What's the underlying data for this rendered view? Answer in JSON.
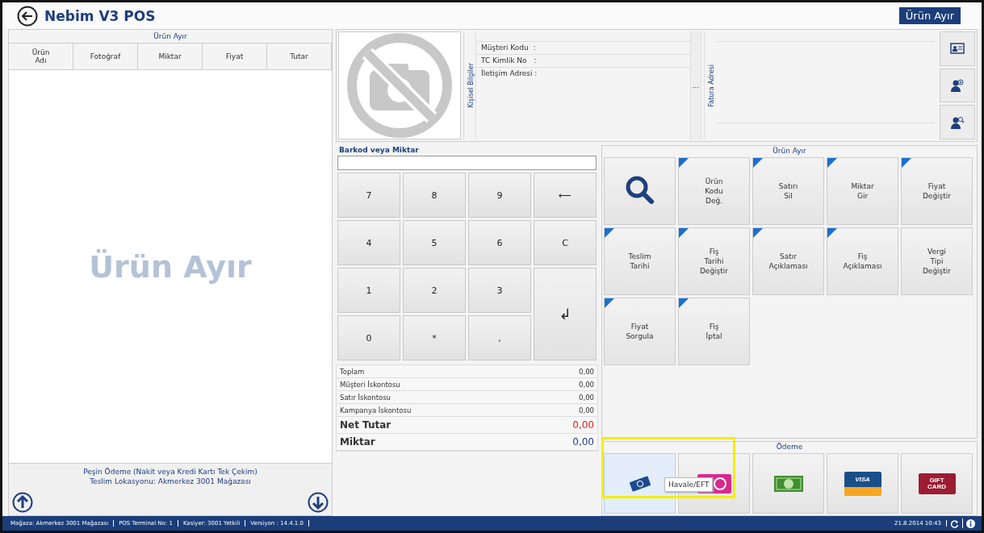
{
  "window": {
    "title": "Nebim V3 POS",
    "action_button": "Ürün Ayır"
  },
  "left_panel": {
    "title": "Ürün Ayır",
    "columns": [
      "Ürün\nAdı",
      "Fotoğraf",
      "Miktar",
      "Fiyat",
      "Tutar"
    ],
    "empty_text": "Ürün Ayır",
    "info_lines": [
      "Peşin Ödeme (Nakit veya Kredi Kartı Tek Çekim)",
      "Teslim Lokasyonu: Akmerkez 3001 Mağazası"
    ]
  },
  "customer": {
    "section_label": "Kişisel Bilgiler",
    "fields": [
      "Müşteri Kodu  :",
      "TC Kimlik No   :",
      "İletişim Adresi :"
    ],
    "address_label": "Fatura Adresi",
    "splitter": "..."
  },
  "barcode": {
    "label": "Barkod veya Miktar"
  },
  "keypad": [
    {
      "label": "7",
      "kind": "digit"
    },
    {
      "label": "8",
      "kind": "digit"
    },
    {
      "label": "9",
      "kind": "digit"
    },
    {
      "label": "⟵",
      "kind": "digit"
    },
    {
      "label": "4",
      "kind": "digit"
    },
    {
      "label": "5",
      "kind": "digit"
    },
    {
      "label": "6",
      "kind": "digit"
    },
    {
      "label": "C",
      "kind": "digit"
    },
    {
      "label": "1",
      "kind": "digit"
    },
    {
      "label": "2",
      "kind": "digit"
    },
    {
      "label": "3",
      "kind": "digit"
    },
    {
      "label": "↲",
      "kind": "enter"
    },
    {
      "label": "0",
      "kind": "digit"
    },
    {
      "label": "*",
      "kind": "digit"
    },
    {
      "label": ",",
      "kind": "digit"
    }
  ],
  "totals": [
    {
      "label": "Toplam",
      "value": "0,00",
      "kind": "plain"
    },
    {
      "label": "Müşteri İskontosu",
      "value": "0,00",
      "kind": "plain"
    },
    {
      "label": "Satır İskontosu",
      "value": "0,00",
      "kind": "plain"
    },
    {
      "label": "Kampanya İskontosu",
      "value": "0,00",
      "kind": "plain"
    },
    {
      "label": "Net Tutar",
      "value": "0,00",
      "kind": "net"
    },
    {
      "label": "Miktar",
      "value": "0,00",
      "kind": "count"
    }
  ],
  "functions": {
    "title": "Ürün Ayır",
    "buttons": [
      {
        "kind": "search",
        "flagged": false
      },
      {
        "kind": "text",
        "label": "Ürün\nKodu\nDeğ.",
        "flagged": true
      },
      {
        "kind": "text",
        "label": "Satırı\nSil",
        "flagged": true
      },
      {
        "kind": "text",
        "label": "Miktar\nGir",
        "flagged": true
      },
      {
        "kind": "text",
        "label": "Fiyat\nDeğiştir",
        "flagged": true
      },
      {
        "kind": "text",
        "label": "Teslim\nTarihi",
        "flagged": true
      },
      {
        "kind": "text",
        "label": "Fiş\nTarihi\nDeğiştir",
        "flagged": true
      },
      {
        "kind": "text",
        "label": "Satır\nAçıklaması",
        "flagged": true
      },
      {
        "kind": "text",
        "label": "Fiş\nAçıklaması",
        "flagged": true
      },
      {
        "kind": "text",
        "label": "Vergi\nTipi\nDeğiştir",
        "flagged": false
      },
      {
        "kind": "text",
        "label": "Fiyat\nSorgula",
        "flagged": true
      },
      {
        "kind": "text",
        "label": "Fiş\nİptal",
        "flagged": true
      }
    ]
  },
  "payment": {
    "title": "Ödeme",
    "tooltip": "Havale/EFT",
    "buttons": [
      {
        "kind": "transfer",
        "hovered": true
      },
      {
        "kind": "pink-card",
        "hovered": false
      },
      {
        "kind": "cash",
        "hovered": false
      },
      {
        "kind": "visa",
        "label": "VISA",
        "hovered": false
      },
      {
        "kind": "gift",
        "label": "GIFT\nCARD",
        "hovered": false
      }
    ]
  },
  "status_bar": {
    "items": [
      "Mağaza: Akmerkez 3001 Mağazası",
      "POS Terminal No: 1",
      "Kasiyer: 3001 Yetkili",
      "Versiyon : 14.4.1.0"
    ],
    "datetime": "21.8.2014 10:43"
  }
}
